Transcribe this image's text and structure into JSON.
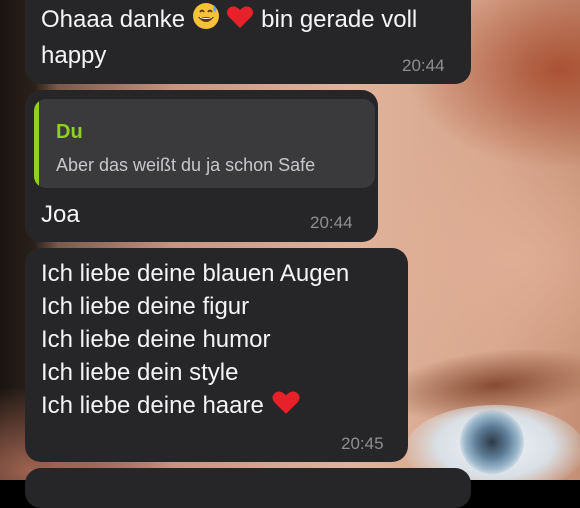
{
  "wallpaper": {
    "description": ""
  },
  "messages": [
    {
      "lines": [
        "Ohaaa danke",
        "bin gerade voll",
        "happy"
      ],
      "emojis": [
        "grinning-sweat-emoji",
        "red-heart-emoji"
      ],
      "time": "20:44"
    },
    {
      "reply": {
        "name": "Du",
        "text": "Aber das weißt du ja schon Safe"
      },
      "lines": [
        "Joa"
      ],
      "time": "20:44"
    },
    {
      "lines": [
        "Ich liebe deine blauen Augen",
        "Ich liebe deine figur",
        "Ich liebe deine humor",
        "Ich liebe dein style",
        "Ich liebe deine haare"
      ],
      "emojis": [
        "red-heart-emoji"
      ],
      "time": "20:45"
    }
  ],
  "colors": {
    "bubble": "#262628",
    "reply_accent": "#8fd020",
    "timestamp": "#8e8e93"
  }
}
